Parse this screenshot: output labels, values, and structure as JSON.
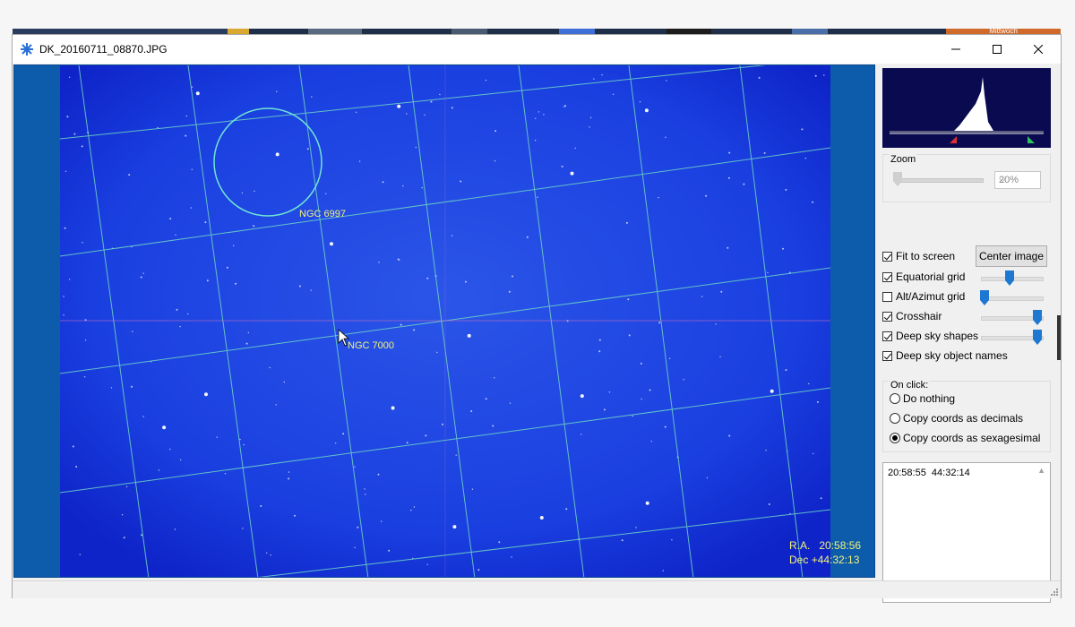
{
  "taskbar": {
    "partial_text": "Mittwoch"
  },
  "window": {
    "title": "DK_20160711_08870.JPG",
    "app_icon": "star-burst-icon",
    "minimize_icon": "minimize-icon",
    "maximize_icon": "maximize-icon",
    "close_icon": "close-icon"
  },
  "viewer": {
    "objects": [
      {
        "name": "NGC 6997"
      },
      {
        "name": "NGC 7000"
      }
    ],
    "coord_ra_label": "R.A.",
    "coord_ra_value": "20:58:56",
    "coord_dec_label": "Dec",
    "coord_dec_value": "+44:32:13",
    "colors": {
      "sky": "#1a3fe0",
      "grid": "#6fd6c4",
      "labels": "#f2f27a"
    }
  },
  "panel": {
    "zoom": {
      "label": "Zoom",
      "value": "20%"
    },
    "options": [
      {
        "label": "Fit to screen",
        "checked": true
      },
      {
        "label": "Equatorial grid",
        "checked": true,
        "slider": 0.5
      },
      {
        "label": "Alt/Azimut grid",
        "checked": false,
        "slider": 0.0
      },
      {
        "label": "Crosshair",
        "checked": true,
        "slider": 1.0
      },
      {
        "label": "Deep sky shapes",
        "checked": true,
        "slider": 1.0
      },
      {
        "label": "Deep sky object names",
        "checked": true
      }
    ],
    "center_button": "Center image",
    "on_click": {
      "label": "On click:",
      "options": [
        {
          "label": "Do nothing",
          "selected": false
        },
        {
          "label": "Copy coords as decimals",
          "selected": false
        },
        {
          "label": "Copy coords as sexagesimal",
          "selected": true
        }
      ]
    },
    "output_text": "20:58:55  44:32:14"
  }
}
